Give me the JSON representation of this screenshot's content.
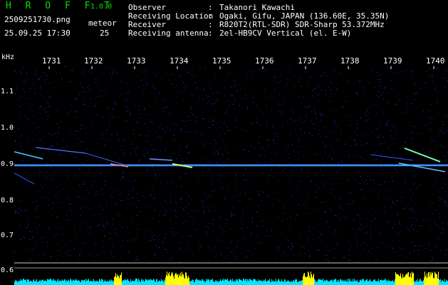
{
  "header": {
    "app_title": "H R O F F T",
    "version": "1.0.0",
    "filename": "2509251730.png",
    "datetime": "25.09.25 17:30",
    "meteor_label": "meteor",
    "meteor_count": "25",
    "info": [
      {
        "label": "Observer",
        "value": "Takanori Kawachi"
      },
      {
        "label": "Receiving Location",
        "value": "Ogaki, Gifu, JAPAN (136.60E, 35.35N)"
      },
      {
        "label": "Receiver",
        "value": "R820T2(RTL-SDR) SDR-Sharp 53.372MHz"
      },
      {
        "label": "Receiving antenna",
        "value": "2el-HB9CV Vertical (el. E-W)"
      }
    ],
    "separator": ":"
  },
  "axes": {
    "y_unit": "kHz",
    "x_ticks": [
      "1731",
      "1732",
      "1733",
      "1734",
      "1735",
      "1736",
      "1737",
      "1738",
      "1739",
      "1740"
    ],
    "y_ticks": [
      "1.1",
      "1.0",
      "0.9",
      "0.8",
      "0.7",
      "0.6"
    ]
  },
  "colors": {
    "background": "#000000",
    "title_green": "#00e000",
    "noise_blue": "#1a2a9a",
    "carrier": "#40d0ff",
    "meteor_trail": "#80ffc0",
    "spectrum_cyan": "#00e8ff",
    "spectrum_yellow": "#ffff00"
  }
}
